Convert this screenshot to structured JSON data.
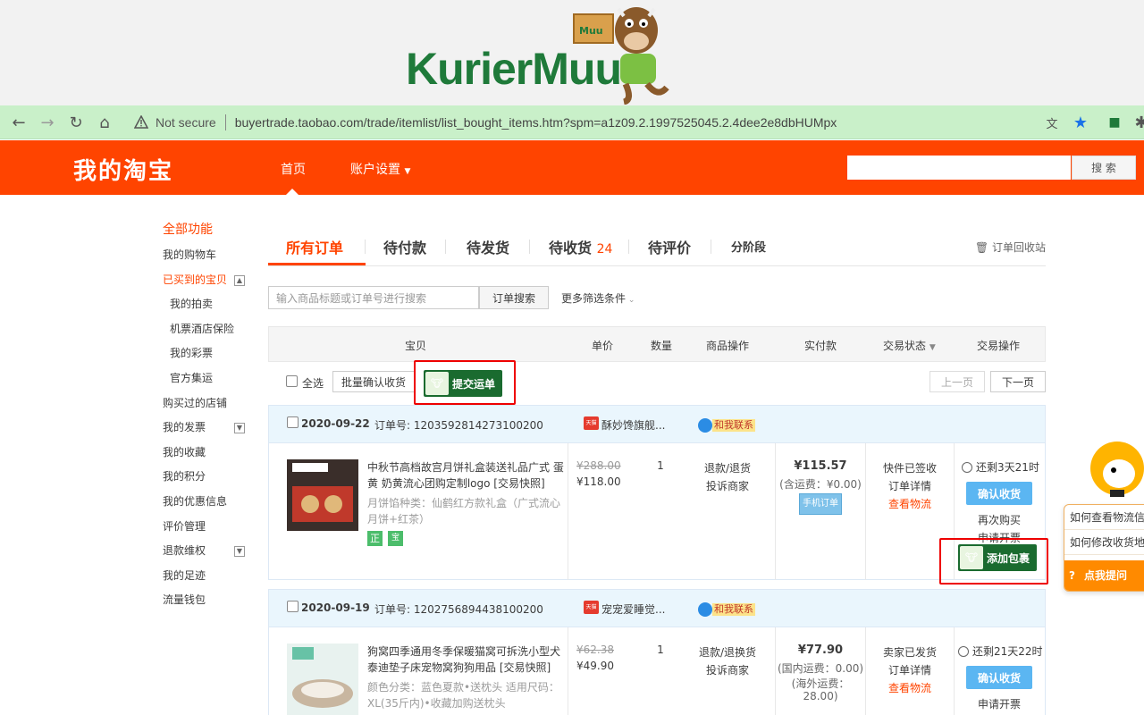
{
  "banner": {
    "logo_text": "KurierMuu",
    "box_label": "Muu"
  },
  "browser": {
    "not_secure": "Not secure",
    "url": "buyertrade.taobao.com/trade/itemlist/list_bought_items.htm?spm=a1z09.2.1997525045.2.4dee2e8dbHUMpx"
  },
  "header": {
    "title": "我的淘宝",
    "nav": [
      "首页",
      "账户设置"
    ],
    "search_button": "搜 索"
  },
  "sidebar": {
    "head": "全部功能",
    "items": [
      {
        "label": "我的购物车"
      },
      {
        "label": "已买到的宝贝",
        "toggle": "▲"
      },
      {
        "label": "我的拍卖"
      },
      {
        "label": "机票酒店保险"
      },
      {
        "label": "我的彩票"
      },
      {
        "label": "官方集运"
      },
      {
        "label": "购买过的店铺"
      },
      {
        "label": "我的发票",
        "toggle": "▼"
      },
      {
        "label": "我的收藏"
      },
      {
        "label": "我的积分"
      },
      {
        "label": "我的优惠信息"
      },
      {
        "label": "评价管理"
      },
      {
        "label": "退款维权",
        "toggle": "▼"
      },
      {
        "label": "我的足迹"
      },
      {
        "label": "流量钱包"
      }
    ]
  },
  "tabs": {
    "items": [
      "所有订单",
      "待付款",
      "待发货",
      "待收货",
      "待评价",
      "分阶段"
    ],
    "pending_receipt_count": "24",
    "recycle_bin": "订单回收站"
  },
  "filter": {
    "search_placeholder": "输入商品标题或订单号进行搜索",
    "search_button": "订单搜索",
    "more_filters": "更多筛选条件"
  },
  "table_header": [
    "宝贝",
    "单价",
    "数量",
    "商品操作",
    "实付款",
    "交易状态",
    "交易操作"
  ],
  "controls": {
    "select_all": "全选",
    "batch_confirm": "批量确认收货",
    "submit_waybill": "提交运单",
    "prev_page": "上一页",
    "next_page": "下一页"
  },
  "orders": [
    {
      "date": "2020-09-22",
      "order_no": "订单号: 1203592814273100200",
      "shop_tag": "天猫",
      "shop": "酥妙馋旗舰...",
      "contact": "和我联系",
      "title": "中秋节高档故宫月饼礼盒装送礼品广式 蛋黄 奶黄流心团购定制logo [交易快照]",
      "attr": "月饼馅种类：仙鹤红方款礼盒（广式流心月饼+红茶）",
      "badges": [
        "正",
        "宝"
      ],
      "orig_price": "¥288.00",
      "price": "¥118.00",
      "qty": "1",
      "ops": [
        "退款/退货",
        "投诉商家"
      ],
      "paid": "¥115.57",
      "shipping": "(含运费：¥0.00)",
      "paid_extra": "",
      "channel": "手机订单",
      "status": [
        "快件已签收",
        "订单详情"
      ],
      "logistics": "查看物流",
      "countdown": "还剩3天21时",
      "confirm": "确认收货",
      "actions": [
        "再次购买",
        "申请开票"
      ],
      "add_package": "添加包裹"
    },
    {
      "date": "2020-09-19",
      "order_no": "订单号: 1202756894438100200",
      "shop_tag": "天猫",
      "shop": "宠宠爱睡觉...",
      "contact": "和我联系",
      "title": "狗窝四季通用冬季保暖猫窝可拆洗小型犬泰迪垫子床宠物窝狗狗用品 [交易快照]",
      "attr": "颜色分类：蓝色夏款•送枕头 适用尺码：XL(35斤内)•收藏加购送枕头",
      "badges": [],
      "orig_price": "¥62.38",
      "price": "¥49.90",
      "qty": "1",
      "ops": [
        "退款/退换货",
        "投诉商家"
      ],
      "paid": "¥77.90",
      "shipping": "(国内运费：0.00)",
      "paid_extra": "(海外运费：28.00)",
      "channel": "",
      "status": [
        "卖家已发货",
        "订单详情"
      ],
      "logistics": "查看物流",
      "countdown": "还剩21天22时",
      "confirm": "确认收货",
      "actions": [
        "申请开票"
      ],
      "add_package": ""
    }
  ],
  "assistant": {
    "lines": [
      "如何查看物流信息",
      "如何修改收货地址"
    ],
    "button": "点我提问"
  },
  "colors": {
    "brand": "#ff4400",
    "confirm": "#5bb6f2",
    "ext_green": "#1a6b2f",
    "highlight": "#ee0000"
  }
}
